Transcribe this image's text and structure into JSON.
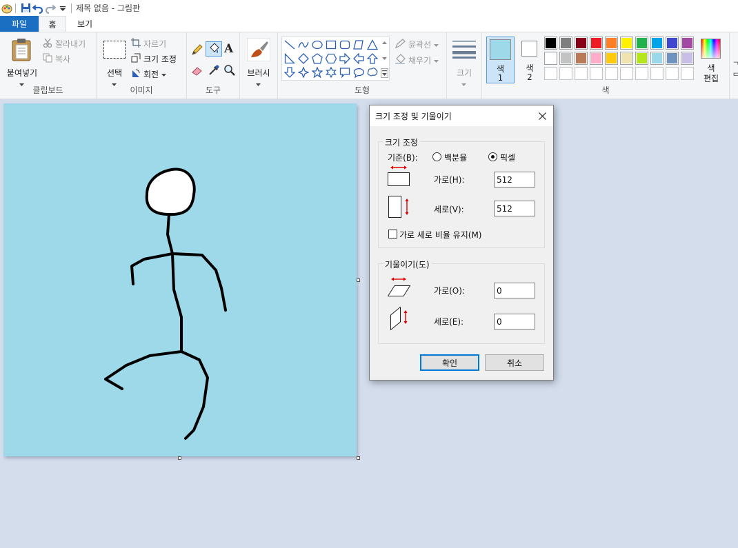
{
  "window": {
    "title": "제목 없음 - 그림판"
  },
  "tabs": [
    {
      "label": "파일"
    },
    {
      "label": "홈"
    },
    {
      "label": "보기"
    }
  ],
  "ribbon": {
    "clipboard": {
      "paste": "붙여넣기",
      "cut": "잘라내기",
      "copy": "복사",
      "label": "클립보드"
    },
    "image": {
      "select": "선택",
      "crop": "자르기",
      "resize": "크기 조정",
      "rotate": "회전",
      "label": "이미지"
    },
    "tools": {
      "label": "도구"
    },
    "brushes": {
      "label": "브러시"
    },
    "shapes": {
      "outline": "윤곽선",
      "fill": "채우기",
      "label": "도형"
    },
    "size": {
      "label": "크기"
    },
    "colors": {
      "color1_label": "색",
      "color1_num": "1",
      "color2_label": "색",
      "color2_num": "2",
      "edit_label": "색",
      "edit_label2": "편집",
      "group_label": "색",
      "color1": "#9ed9e9",
      "color2": "#ffffff",
      "palette_row1": [
        "#000000",
        "#7f7f7f",
        "#880015",
        "#ed1c24",
        "#ff7f27",
        "#fff200",
        "#22b14c",
        "#00a2e8",
        "#3f48cc",
        "#a349a4"
      ],
      "palette_row2": [
        "#ffffff",
        "#c3c3c3",
        "#b97a57",
        "#ffaec9",
        "#ffc90e",
        "#efe4b0",
        "#b5e61d",
        "#99d9ea",
        "#7092be",
        "#c8bfe7"
      ],
      "palette_row3": [
        "#ffffff",
        "#ffffff",
        "#ffffff",
        "#ffffff",
        "#ffffff",
        "#ffffff",
        "#ffffff",
        "#ffffff",
        "#ffffff",
        "#ffffff"
      ]
    }
  },
  "dialog": {
    "title": "크기 조정 및 기울이기",
    "resize": {
      "legend": "크기 조정",
      "basis_label": "기준(B):",
      "percent_label": "백분율",
      "pixel_label": "픽셀",
      "selected": "pixel",
      "horizontal_label": "가로(H):",
      "horizontal_value": "512",
      "vertical_label": "세로(V):",
      "vertical_value": "512",
      "keep_ratio_label": "가로 세로 비율 유지(M)",
      "keep_ratio": false
    },
    "skew": {
      "legend": "기울이기(도)",
      "horizontal_label": "가로(O):",
      "horizontal_value": "0",
      "vertical_label": "세로(E):",
      "vertical_value": "0"
    },
    "ok_label": "확인",
    "cancel_label": "취소"
  }
}
